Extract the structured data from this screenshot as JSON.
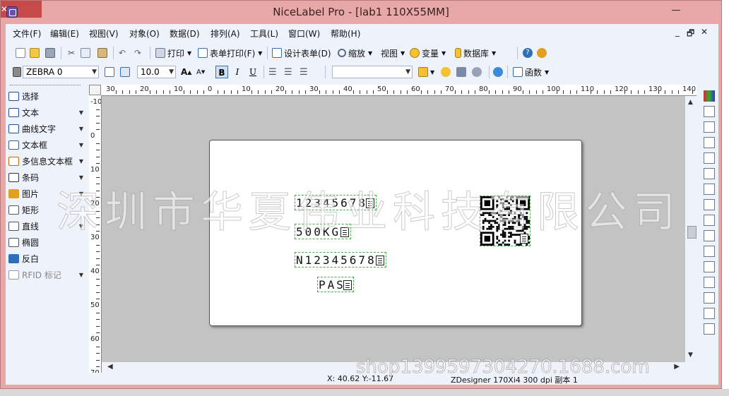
{
  "window": {
    "title": "NiceLabel Pro - [lab1 110X55MM]",
    "min_symbol": "—",
    "max_symbol": "☐",
    "close_symbol": "✕"
  },
  "menu": {
    "items": [
      "文件(F)",
      "编辑(E)",
      "视图(V)",
      "对象(O)",
      "数据(D)",
      "排列(A)",
      "工具(L)",
      "窗口(W)",
      "帮助(H)"
    ],
    "mdi_controls": [
      "_",
      "🗗",
      "✕"
    ]
  },
  "toolbar1": {
    "print": "打印",
    "form_print": "表单打印(F)",
    "design_form": "设计表单(D)",
    "zoom": "缩放",
    "view": "视图",
    "variable": "变量",
    "database": "数据库"
  },
  "toolbar2": {
    "printer": "ZEBRA 0",
    "font_size": "10.0",
    "bold": "B",
    "italic": "I",
    "underline": "U",
    "function": "函数",
    "font_name": ""
  },
  "left_panel": {
    "items": [
      {
        "label": "选择",
        "icon": "pointer-icon",
        "arrow": false
      },
      {
        "label": "文本",
        "icon": "text-icon",
        "arrow": true
      },
      {
        "label": "曲线文字",
        "icon": "curved-text-icon",
        "arrow": true
      },
      {
        "label": "文本框",
        "icon": "textbox-icon",
        "arrow": true
      },
      {
        "label": "多信息文本框",
        "icon": "rtf-icon",
        "arrow": true
      },
      {
        "label": "条码",
        "icon": "barcode-icon",
        "arrow": true
      },
      {
        "label": "图片",
        "icon": "picture-icon",
        "arrow": true
      },
      {
        "label": "矩形",
        "icon": "rectangle-icon",
        "arrow": false
      },
      {
        "label": "直线",
        "icon": "line-icon",
        "arrow": true
      },
      {
        "label": "椭圆",
        "icon": "ellipse-icon",
        "arrow": false
      },
      {
        "label": "反白",
        "icon": "inverse-icon",
        "arrow": false
      },
      {
        "label": "RFID 标记",
        "icon": "rfid-icon",
        "arrow": true
      }
    ]
  },
  "ruler": {
    "h_labels": [
      "30",
      "20",
      "10",
      "0",
      "10",
      "20",
      "30",
      "40",
      "50",
      "60",
      "70",
      "80",
      "90",
      "100",
      "110",
      "120",
      "130",
      "140"
    ],
    "v_labels": [
      "-10",
      "0",
      "10",
      "20",
      "30",
      "40",
      "50",
      "60",
      "70"
    ]
  },
  "label": {
    "fields": [
      {
        "text": "12345678"
      },
      {
        "text": "500KG"
      },
      {
        "text": "N12345678"
      },
      {
        "text": "PAS"
      }
    ]
  },
  "status": {
    "coords": "X: 40.62 Y:-11.67",
    "printer_info": "ZDesigner 170Xi4 300 dpi 副本 1"
  },
  "watermark": {
    "company": "深圳市华夏伟业科技有限公司",
    "shop": "shop1399597304270.1688.com"
  }
}
